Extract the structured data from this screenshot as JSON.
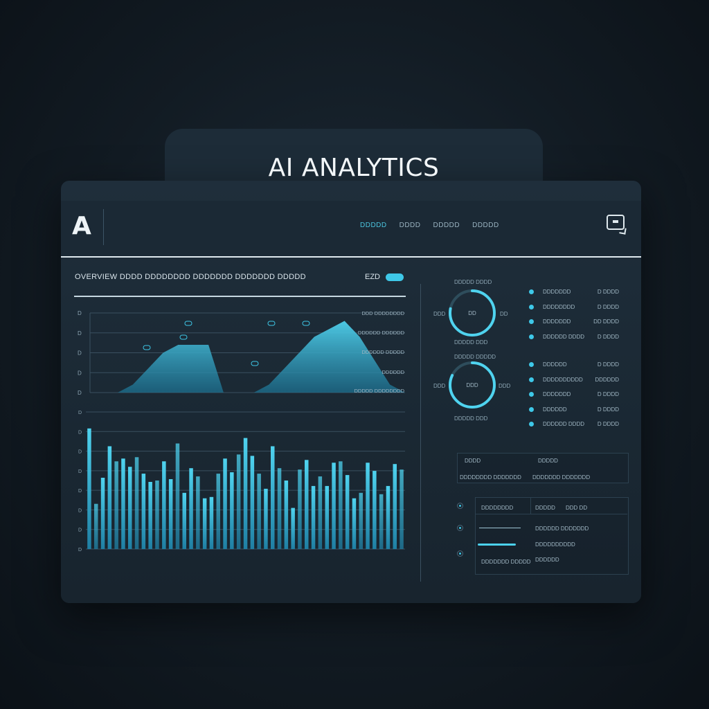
{
  "app": {
    "title": "AI ANALYTICS",
    "logo": "A"
  },
  "nav": {
    "links": [
      "DDDDD",
      "DDDD",
      "DDDDD",
      "DDDDD"
    ]
  },
  "overview": {
    "title": "OVERVIEW DDDD DDDDDDDD DDDDDDD DDDDDDD DDDDD",
    "value": "EZD"
  },
  "area_chart_labels": [
    "DDD DDDDDDDD",
    "DDDDDD DDDDDD",
    "DDDDDD DDDDD",
    "DDDDDD",
    "DDDDD DDDDDDDD"
  ],
  "gauges": [
    {
      "top": "DDDDD DDDD",
      "center": "DD",
      "left": "DDD",
      "right": "DD",
      "bottom": "DDDDD DDD",
      "level": 0.78
    },
    {
      "top": "DDDDD DDDDD",
      "center": "DDD",
      "left": "DDD",
      "right": "DDD",
      "bottom": "DDDDD DDD",
      "level": 0.82
    }
  ],
  "list_a": [
    {
      "label": "DDDDDDD",
      "value": "D DDDD"
    },
    {
      "label": "DDDDDDDD",
      "value": "D DDDD"
    },
    {
      "label": "DDDDDDD",
      "value": "DD DDDD"
    },
    {
      "label": "DDDDDD DDDD",
      "value": "D DDDD"
    }
  ],
  "list_b": [
    {
      "label": "DDDDDD",
      "value": "D DDDD"
    },
    {
      "label": "DDDDDDDDDD",
      "value": "DDDDDD"
    },
    {
      "label": "DDDDDDD",
      "value": "D DDDD"
    },
    {
      "label": "DDDDDD",
      "value": "D DDDD"
    },
    {
      "label": "DDDDDD DDDD",
      "value": "D DDDD"
    }
  ],
  "panel_top": {
    "h1": "DDDD",
    "h2": "DDDDD",
    "row1": "DDDDDDDD DDDDDDD",
    "row2": "DDDDDDD DDDDDDD"
  },
  "panel_bottom": {
    "h1": "DDDDDDDD",
    "h2": "DDDDD",
    "h3": "DDD DD",
    "r1": "DDDDDD DDDDDDD",
    "r2": "DDDDDDDDDD",
    "r3": "DDDDDD",
    "r4": "DDDDDDD DDDDD"
  },
  "chart_data": [
    {
      "type": "area",
      "title": "",
      "y_ticks": [
        "D",
        "D",
        "D",
        "D",
        "D"
      ],
      "series": [
        {
          "values": [
            0,
            1,
            3,
            5,
            6,
            6,
            6,
            0,
            0,
            0,
            1,
            3,
            5,
            7,
            8,
            9,
            7,
            4,
            1,
            0
          ]
        }
      ],
      "ylim": [
        0,
        10
      ],
      "markers": [
        "D",
        "D",
        "D",
        "D",
        "D",
        "D",
        "D"
      ]
    },
    {
      "type": "bar",
      "title": "",
      "y_ticks": [
        "D",
        "D",
        "D",
        "D",
        "D",
        "D",
        "D",
        "D"
      ],
      "series": [
        {
          "values": [
            88,
            33,
            52,
            75,
            64,
            66,
            60,
            67,
            55,
            49,
            50,
            64,
            51,
            77,
            41,
            59,
            53,
            37,
            38,
            55,
            66,
            56,
            69,
            81,
            68,
            55,
            44,
            75,
            59,
            50,
            30,
            58,
            65,
            46,
            53,
            46,
            63,
            64,
            54,
            37,
            41,
            63,
            57,
            40,
            46,
            62,
            58
          ]
        }
      ],
      "ylim": [
        0,
        100
      ]
    }
  ],
  "colors": {
    "accent": "#3ec8e8",
    "background": "#121b23",
    "window": "#1d2c38"
  }
}
